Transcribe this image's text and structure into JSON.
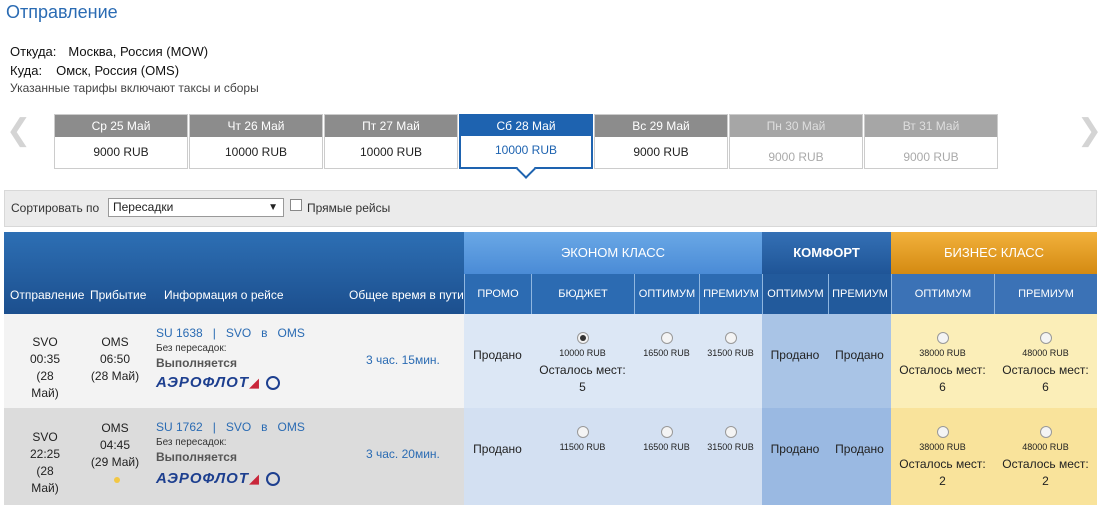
{
  "page": {
    "title": "Отправление"
  },
  "route": {
    "from_label": "Откуда:",
    "from_value": "Москва, Россия (MOW)",
    "to_label": "Куда:",
    "to_value": "Омск, Россия (OMS)",
    "note": "Указанные тарифы включают таксы и сборы"
  },
  "dates": [
    {
      "day": "Ср 25 Май",
      "price": "9000 RUB",
      "state": "normal"
    },
    {
      "day": "Чт 26 Май",
      "price": "10000 RUB",
      "state": "normal"
    },
    {
      "day": "Пт 27 Май",
      "price": "10000 RUB",
      "state": "normal"
    },
    {
      "day": "Сб 28 Май",
      "price": "10000 RUB",
      "state": "selected"
    },
    {
      "day": "Вс 29 Май",
      "price": "9000 RUB",
      "state": "normal"
    },
    {
      "day": "Пн 30 Май",
      "price": "9000 RUB",
      "state": "disabled"
    },
    {
      "day": "Вт 31 Май",
      "price": "9000 RUB",
      "state": "disabled"
    }
  ],
  "sort": {
    "label": "Сортировать по",
    "selected": "Пересадки",
    "direct_label": "Прямые рейсы"
  },
  "columns": {
    "departure": "Отправление",
    "arrival": "Прибытие",
    "info": "Информация о рейсе",
    "total_time": "Общее время в пути",
    "economy": "ЭКОНОМ КЛАСС",
    "comfort": "КОМФОРТ",
    "business": "БИЗНЕС КЛАСС",
    "promo": "ПРОМО",
    "budget": "БЮДЖЕТ",
    "optimum": "ОПТИМУМ",
    "premium": "ПРЕМИУМ"
  },
  "flights": [
    {
      "dep_code": "SVO",
      "dep_time": "00:35",
      "dep_date": "(28 Май)",
      "arr_code": "OMS",
      "arr_time": "06:50",
      "arr_date": "(28 Май)",
      "flight_no": "SU 1638",
      "sep1": "|",
      "from": "SVO",
      "in": "в",
      "to": "OMS",
      "stops": "Без пересадок:",
      "status": "Выполняется",
      "airline": "АЭРОФЛОТ",
      "duration": "3 час. 15мин.",
      "promo": "Продано",
      "budget_price": "10000 RUB",
      "budget_seats_label": "Осталось мест:",
      "budget_seats": "5",
      "eco_opt_price": "16500 RUB",
      "eco_prem_price": "31500 RUB",
      "comf_opt": "Продано",
      "comf_prem": "Продано",
      "biz_opt_price": "38000 RUB",
      "biz_opt_seats_label": "Осталось мест:",
      "biz_opt_seats": "6",
      "biz_prem_price": "48000 RUB",
      "biz_prem_seats_label": "Осталось мест:",
      "biz_prem_seats": "6"
    },
    {
      "dep_code": "SVO",
      "dep_time": "22:25",
      "dep_date": "(28 Май)",
      "arr_code": "OMS",
      "arr_time": "04:45",
      "arr_date": "(29 Май)",
      "flight_no": "SU 1762",
      "sep1": "|",
      "from": "SVO",
      "in": "в",
      "to": "OMS",
      "stops": "Без пересадок:",
      "status": "Выполняется",
      "airline": "АЭРОФЛОТ",
      "duration": "3 час. 20мин.",
      "promo": "Продано",
      "budget_price": "11500 RUB",
      "eco_opt_price": "16500 RUB",
      "eco_prem_price": "31500 RUB",
      "comf_opt": "Продано",
      "comf_prem": "Продано",
      "biz_opt_price": "38000 RUB",
      "biz_opt_seats_label": "Осталось мест:",
      "biz_opt_seats": "2",
      "biz_prem_price": "48000 RUB",
      "biz_prem_seats_label": "Осталось мест:",
      "biz_prem_seats": "2"
    }
  ],
  "colors": {
    "accent": "#1e63b0",
    "economy": "#5596dc",
    "business": "#e59f22",
    "economy_cell": "#dce7f5",
    "comfort_cell": "#a9c4e6",
    "business_cell": "#fbeeb8"
  }
}
